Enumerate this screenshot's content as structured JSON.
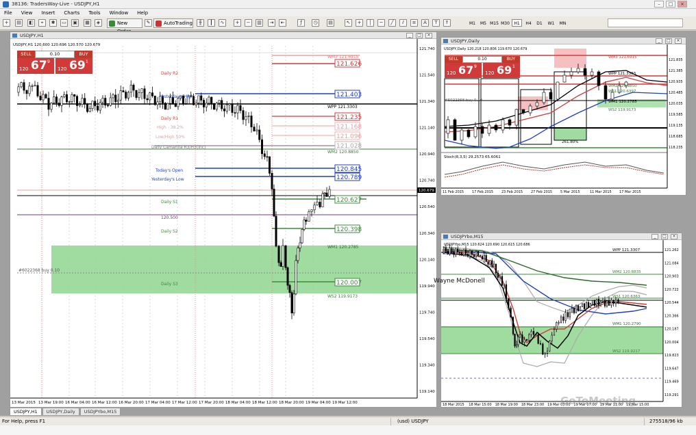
{
  "window": {
    "title": "38136: TradersWay-Live - USDJPY,H1"
  },
  "menu": [
    "File",
    "View",
    "Insert",
    "Charts",
    "Tools",
    "Window",
    "Help"
  ],
  "toolbar": {
    "new_order": "New Order",
    "autotrading": "AutoTrading",
    "timeframes": [
      "M1",
      "M5",
      "M15",
      "M30",
      "H1",
      "H4",
      "D1",
      "W1",
      "MN"
    ],
    "active_timeframe": "H1"
  },
  "charts": {
    "h1": {
      "title": "USDJPY,H1",
      "ohlc": "USDJPY,H1  120.600 120.696 120.570 120.679",
      "sell_label": "SELL",
      "buy_label": "BUY",
      "lot": "0.10",
      "bid_prefix": "120",
      "bid_big": "67",
      "bid_sup": "9",
      "ask_prefix": "120",
      "ask_big": "69",
      "ask_sup": "1",
      "price_axis": [
        "121.740",
        "121.540",
        "121.340",
        "121.140",
        "120.940",
        "120.740",
        "120.540",
        "120.340",
        "120.140",
        "119.940",
        "119.740",
        "119.540",
        "119.340",
        "119.140"
      ],
      "current_price_tag": "120.679",
      "time_axis": [
        "13 Mar 2015",
        "13 Mar 19:00",
        "16 Mar 04:00",
        "16 Mar 12:00",
        "16 Mar 20:00",
        "17 Mar 04:00",
        "17 Mar 12:00",
        "17 Mar 20:00",
        "18 Mar 04:00",
        "18 Mar 12:00",
        "18 Mar 20:00",
        "19 Mar 04:00",
        "19 Mar 12:00"
      ],
      "level_boxes": [
        "121.626",
        "121.403",
        "121.235",
        "121.168",
        "121.096",
        "121.028",
        "120.845",
        "120.789",
        "120.627",
        "120.398",
        "120.007"
      ],
      "labels": {
        "daily_r2": "Daily R2",
        "yesterday_high": "Yesterday's High",
        "daily_r1": "Daily R1",
        "high_38": "High - 38.2%",
        "low_high_50": "Low/High 50%",
        "daily_camarilla": "Daily Camarilla R3/H3(inc)",
        "todays_open": "Today's Open",
        "yesterday_low": "Yesterday's Low",
        "daily_s1": "Daily S1",
        "round_120500": "120.500",
        "daily_s2": "Daily S2",
        "daily_s3": "Daily S3",
        "order": "#6022368 buy 0.10",
        "wm3": "WM3 121.6915",
        "wpp": "WPP 121.3303",
        "wm2": "WM2 120.8850",
        "wm1": "WM1 120.2785",
        "ws2": "WS2 119.9173"
      }
    },
    "daily": {
      "title": "USDJPY,Daily",
      "ohlc": "USDJPY,Daily  120.218 120.806 119.670 120.679",
      "sell_label": "SELL",
      "buy_label": "BUY",
      "lot": "0.10",
      "bid_prefix": "120",
      "bid_big": "67",
      "bid_sup": "9",
      "ask_prefix": "120",
      "ask_big": "69",
      "ask_sup": "1",
      "stoch": "Stoch(8,3,5) 29.2573 65.6061",
      "order": "#6022368 buy 0.10",
      "price_axis": [
        "121.835",
        "121.385",
        "120.935",
        "120.485",
        "120.035",
        "119.585",
        "119.135",
        "118.685",
        "118.235"
      ],
      "time_axis": [
        "11 Feb 2015",
        "17 Feb 2015",
        "23 Feb 2015",
        "27 Feb 2015",
        "5 Mar 2015",
        "11 Mar 2015",
        "17 Mar 2015"
      ],
      "labels": {
        "wm3": "WM3 121.6915",
        "wpp": "WPP 121.3303",
        "wm2": "WM2 120.8850",
        "ws1": "WS1 120.6397",
        "wm1": "WM1 120.2785",
        "ws2": "WS2 119.9173",
        "box_pct": "261.80%"
      }
    },
    "m15": {
      "title": "USDJPYbo,M15",
      "ohlc": "USDJPYbo,M15  120.624 120.690 120.615 120.686",
      "price_axis": [
        "121.262",
        "121.084",
        "120.903",
        "120.722",
        "120.544",
        "120.366",
        "120.187",
        "120.004",
        "119.823",
        "119.647",
        "119.469",
        "119.291"
      ],
      "time_axis": [
        "18 Mar 2015",
        "18 Mar 15:00",
        "18 Mar 19:00",
        "18 Mar 23:00",
        "19 Mar 03:00",
        "19 Mar 07:00",
        "19 Mar 11:00",
        "19 Mar 15:00"
      ],
      "labels": {
        "wpp": "WPP 121.3307",
        "wm2": "WM2 120.8835",
        "ws1": "WS1 120.6363",
        "wm1": "WM1 120.2790",
        "ws2": "WS2 119.9217"
      }
    }
  },
  "tabs": [
    "USDJPY,H1",
    "USDJPY,Daily",
    "USDJPYbo,M15"
  ],
  "active_tab": "USDJPY,H1",
  "status": {
    "help": "For Help, press F1",
    "profile": "(usd) USDJPY",
    "traffic": "275518/96 kb"
  },
  "overlay": {
    "cursor_name": "Wayne McDonell",
    "watermark": "GoToMeeting"
  },
  "colors": {
    "sell": "#c0392b",
    "buy": "#c0392b",
    "green_zone": "#8fd68f",
    "level_blue": "#1f3fbf",
    "level_red": "#d23a3a"
  }
}
